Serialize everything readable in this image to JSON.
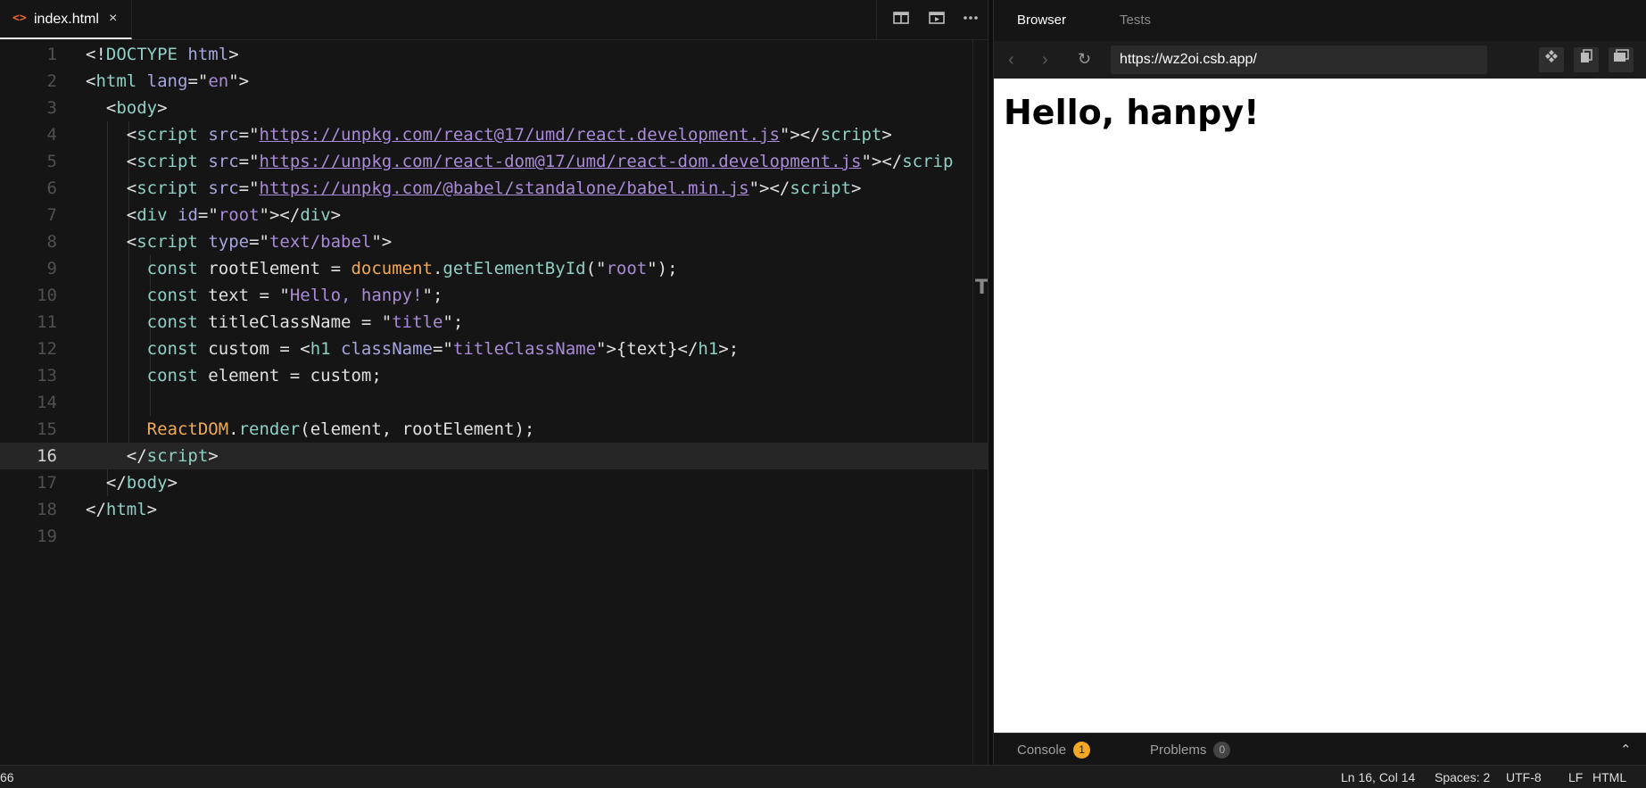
{
  "editor": {
    "tab": {
      "icon": "code-file-icon",
      "filename": "index.html",
      "close": "×"
    },
    "actions": [
      "split-editor-icon",
      "preview-icon",
      "more-icon"
    ],
    "current_line": 16,
    "lines": [
      {
        "n": "1",
        "html": "<span class='t-p'>&lt;!</span><span class='t-tag'>DOCTYPE</span> <span class='t-attr'>html</span><span class='t-p'>&gt;</span>"
      },
      {
        "n": "2",
        "html": "<span class='t-p'>&lt;</span><span class='t-tag'>html</span> <span class='t-attr'>lang</span><span class='t-p'>=\"</span><span class='t-str'>en</span><span class='t-p'>\"&gt;</span>"
      },
      {
        "n": "3",
        "html": "  <span class='t-p'>&lt;</span><span class='t-tag'>body</span><span class='t-p'>&gt;</span>"
      },
      {
        "n": "4",
        "html": "    <span class='t-p'>&lt;</span><span class='t-tag'>script</span> <span class='t-attr'>src</span><span class='t-p'>=\"</span><span class='t-url'>https://unpkg.com/react@17/umd/react.development.js</span><span class='t-p'>\"&gt;&lt;/</span><span class='t-tag'>script</span><span class='t-p'>&gt;</span>"
      },
      {
        "n": "5",
        "html": "    <span class='t-p'>&lt;</span><span class='t-tag'>script</span> <span class='t-attr'>src</span><span class='t-p'>=\"</span><span class='t-url'>https://unpkg.com/react-dom@17/umd/react-dom.development.js</span><span class='t-p'>\"&gt;&lt;/</span><span class='t-tag'>scrip</span>"
      },
      {
        "n": "6",
        "html": "    <span class='t-p'>&lt;</span><span class='t-tag'>script</span> <span class='t-attr'>src</span><span class='t-p'>=\"</span><span class='t-url'>https://unpkg.com/@babel/standalone/babel.min.js</span><span class='t-p'>\"&gt;&lt;/</span><span class='t-tag'>script</span><span class='t-p'>&gt;</span>"
      },
      {
        "n": "7",
        "html": "    <span class='t-p'>&lt;</span><span class='t-tag'>div</span> <span class='t-attr'>id</span><span class='t-p'>=\"</span><span class='t-str'>root</span><span class='t-p'>\"&gt;&lt;/</span><span class='t-tag'>div</span><span class='t-p'>&gt;</span>"
      },
      {
        "n": "8",
        "html": "    <span class='t-p'>&lt;</span><span class='t-tag'>script</span> <span class='t-attr'>type</span><span class='t-p'>=\"</span><span class='t-str'>text/babel</span><span class='t-p'>\"&gt;</span>"
      },
      {
        "n": "9",
        "html": "      <span class='t-kw'>const</span> <span class='t-p'>rootElement = </span><span class='t-obj'>document</span><span class='t-p'>.</span><span class='t-fn'>getElementById</span><span class='t-p'>(\"</span><span class='t-str'>root</span><span class='t-p'>\");</span>"
      },
      {
        "n": "10",
        "html": "      <span class='t-kw'>const</span> <span class='t-p'>text = \"</span><span class='t-str'>Hello, hanpy!</span><span class='t-p'>\";</span>"
      },
      {
        "n": "11",
        "html": "      <span class='t-kw'>const</span> <span class='t-p'>titleClassName = \"</span><span class='t-str'>title</span><span class='t-p'>\";</span>"
      },
      {
        "n": "12",
        "html": "      <span class='t-kw'>const</span> <span class='t-p'>custom = &lt;</span><span class='t-tag'>h1</span> <span class='t-attr'>className</span><span class='t-p'>=\"</span><span class='t-str'>titleClassName</span><span class='t-p'>\"&gt;{text}&lt;/</span><span class='t-tag'>h1</span><span class='t-p'>&gt;;</span>"
      },
      {
        "n": "13",
        "html": "      <span class='t-kw'>const</span> <span class='t-p'>element = custom;</span>"
      },
      {
        "n": "14",
        "html": ""
      },
      {
        "n": "15",
        "html": "      <span class='t-obj'>ReactDOM</span><span class='t-p'>.</span><span class='t-fn'>render</span><span class='t-p'>(element, rootElement);</span>"
      },
      {
        "n": "16",
        "html": "    <span class='t-p'>&lt;/</span><span class='t-tag'>script</span><span class='t-p'>&gt;</span>"
      },
      {
        "n": "17",
        "html": "  <span class='t-p'>&lt;/</span><span class='t-tag'>body</span><span class='t-p'>&gt;</span>"
      },
      {
        "n": "18",
        "html": "<span class='t-p'>&lt;/</span><span class='t-tag'>html</span><span class='t-p'>&gt;</span>"
      },
      {
        "n": "19",
        "html": ""
      }
    ],
    "scroll_marker": "T"
  },
  "preview": {
    "tabs": {
      "browser": "Browser",
      "tests": "Tests"
    },
    "nav": {
      "back": "‹",
      "forward": "›",
      "refresh": "↻"
    },
    "url": "https://wz2oi.csb.app/",
    "url_buttons": [
      "open-external-icon",
      "copy-icon",
      "window-icon"
    ],
    "page_heading": "Hello, hanpy!",
    "bottom_tabs": {
      "console": "Console",
      "console_count": "1",
      "problems": "Problems",
      "problems_count": "0"
    },
    "collapse": "⌃"
  },
  "status": {
    "left": "66",
    "position": "Ln 16, Col 14",
    "spaces": "Spaces: 2",
    "encoding": "UTF-8",
    "eol": "LF",
    "language": "HTML"
  },
  "colors": {
    "accent": "#e5683b",
    "console_badge": "#f5a623",
    "problems_badge": "#444444"
  }
}
